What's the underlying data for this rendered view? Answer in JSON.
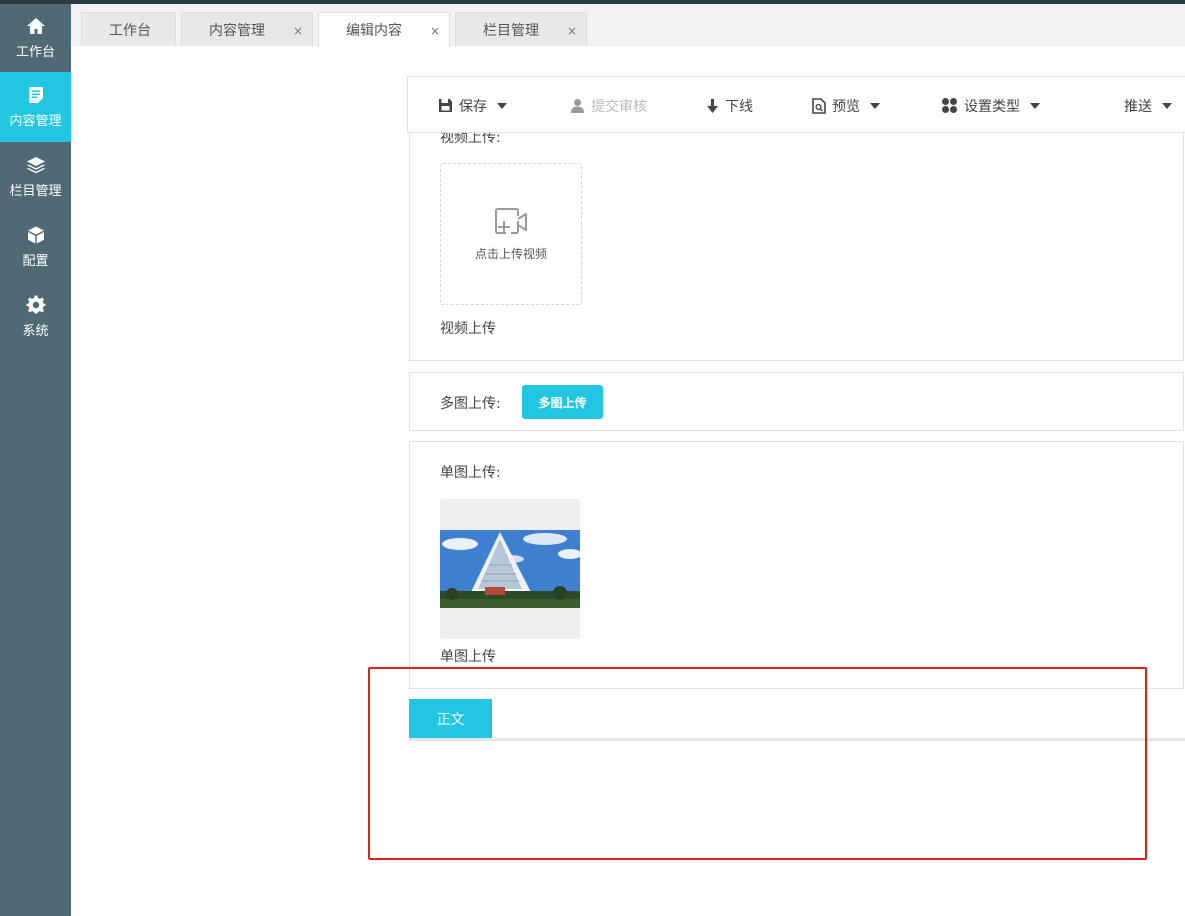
{
  "sidebar": {
    "items": [
      {
        "label": "工作台",
        "icon": "home-icon"
      },
      {
        "label": "内容管理",
        "icon": "document-icon",
        "active": true
      },
      {
        "label": "栏目管理",
        "icon": "layers-icon"
      },
      {
        "label": "配置",
        "icon": "cube-icon"
      },
      {
        "label": "系统",
        "icon": "gear-icon"
      }
    ],
    "active_color": "#23c6e0",
    "bg_color": "#506a75"
  },
  "tabs": [
    {
      "label": "工作台",
      "closable": false
    },
    {
      "label": "内容管理",
      "closable": true,
      "close": "×"
    },
    {
      "label": "编辑内容",
      "closable": true,
      "active": true,
      "close": "×"
    },
    {
      "label": "栏目管理",
      "closable": true,
      "close": "×"
    }
  ],
  "toolbar": {
    "save": "保存",
    "submit_review": "提交审核",
    "offline": "下线",
    "preview": "预览",
    "set_type": "设置类型",
    "push": "推送"
  },
  "video_section": {
    "label": "视频上传:",
    "upload_text": "点击上传视频",
    "caption": "视频上传"
  },
  "multi_image_section": {
    "label": "多图上传:",
    "button": "多图上传"
  },
  "single_image_section": {
    "label": "单图上传:",
    "caption": "单图上传"
  },
  "body_tab": {
    "label": "正文"
  }
}
